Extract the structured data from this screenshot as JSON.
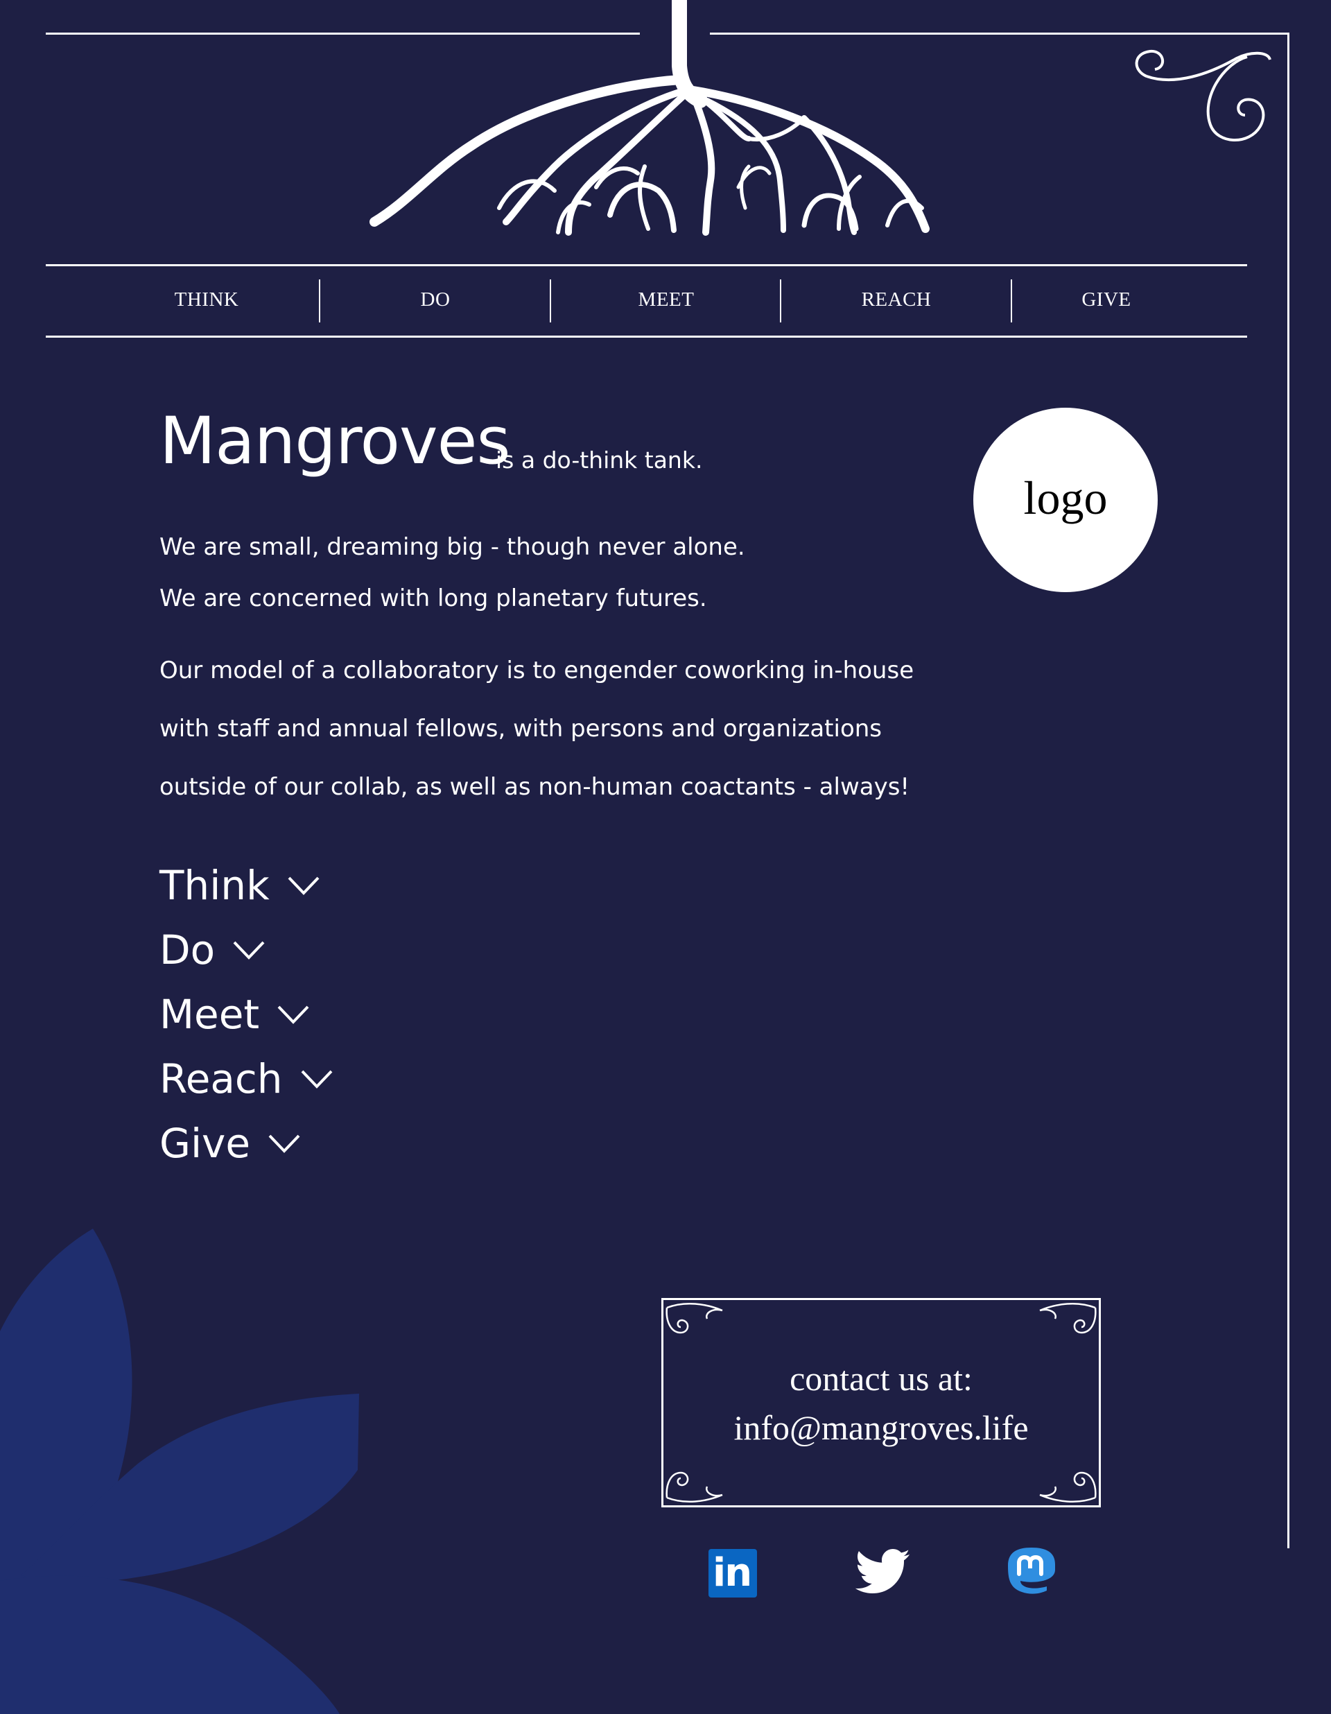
{
  "nav": {
    "items": [
      {
        "label": "THINK"
      },
      {
        "label": "DO"
      },
      {
        "label": "MEET"
      },
      {
        "label": "REACH"
      },
      {
        "label": "GIVE"
      }
    ]
  },
  "intro": {
    "title": "Mangroves",
    "tagline": "is a do-think tank.",
    "lines": [
      "We are small, dreaming big - though never alone.",
      "We are concerned with long planetary futures.",
      "Our model of a collaboratory is to engender coworking in-house",
      "with staff and annual fellows, with persons and organizations",
      "outside of our collab, as well as non-human coactants - always!"
    ]
  },
  "logo": {
    "text": "logo"
  },
  "menu": {
    "items": [
      {
        "label": "Think",
        "icon": "chevron-down-icon"
      },
      {
        "label": "Do",
        "icon": "chevron-down-icon"
      },
      {
        "label": "Meet",
        "icon": "chevron-down-icon"
      },
      {
        "label": "Reach",
        "icon": "chevron-down-icon"
      },
      {
        "label": "Give",
        "icon": "chevron-down-icon"
      }
    ]
  },
  "contact": {
    "heading": "contact us at:",
    "email": "info@mangroves.life"
  },
  "social": {
    "linkedin_text": "in",
    "icons": [
      "linkedin-icon",
      "twitter-icon",
      "mastodon-icon"
    ]
  },
  "colors": {
    "background": "#1e1f44",
    "foreground": "#ffffff",
    "leaf": "#1f2e6e",
    "linkedin": "#0a66c2",
    "mastodon": "#2f8ee0"
  }
}
